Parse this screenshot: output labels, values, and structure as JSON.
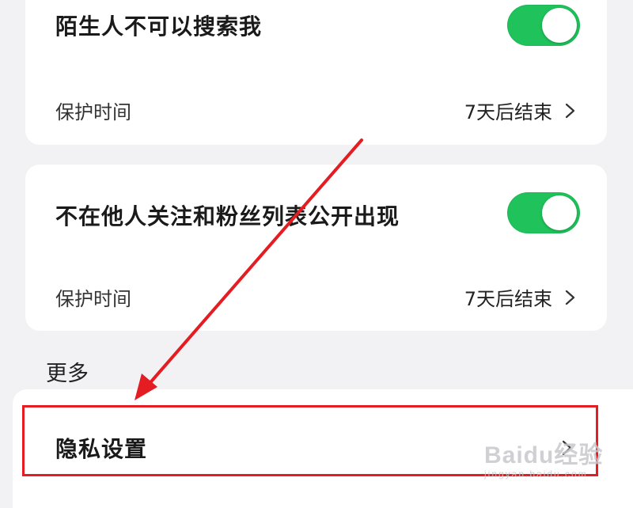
{
  "settings": [
    {
      "title": "陌生人不可以搜索我",
      "enabled": true,
      "protection_label": "保护时间",
      "protection_value": "7天后结束"
    },
    {
      "title": "不在他人关注和粉丝列表公开出现",
      "enabled": true,
      "protection_label": "保护时间",
      "protection_value": "7天后结束"
    }
  ],
  "more_section": {
    "heading": "更多",
    "privacy_settings_label": "隐私设置"
  },
  "annotation": {
    "arrow_color": "#e41d23",
    "box_color": "#e41d23"
  },
  "watermark": {
    "main": "Baidu经验",
    "sub": "jingyan.baidu.com"
  },
  "colors": {
    "toggle_on": "#1fc25b",
    "background": "#f2f2f4",
    "card": "#ffffff"
  }
}
